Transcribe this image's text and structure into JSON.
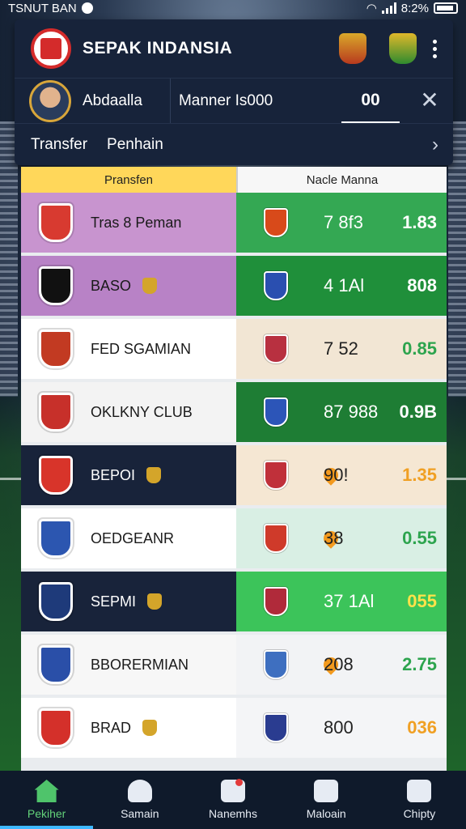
{
  "status": {
    "left_text": "TSNUT BAN",
    "battery": "8:2%"
  },
  "header": {
    "title": "SEPAK INDANSIA",
    "user_name": "Abdaalla",
    "manager_text": "Manner Is000",
    "score": "00",
    "tabs": [
      "Transfer",
      "Penhain"
    ]
  },
  "table": {
    "col1": "Pransfen",
    "col2": "Nacle Manna",
    "rows": [
      {
        "name": "Tras 8 Peman",
        "v1": "7 8f3",
        "v2": "1.83",
        "left_bg": "#c894cf",
        "right_bg": "#34a853",
        "dark": false,
        "v2_color": "#ffffff",
        "v1_color": "#ffffff",
        "pin": false,
        "mini": false,
        "badge_l": "#d83a30",
        "badge_r": "#d84a1a"
      },
      {
        "name": "BASO",
        "v1": "4 1Al",
        "v2": "808",
        "left_bg": "#b882c6",
        "right_bg": "#1f8f3a",
        "dark": false,
        "v2_color": "#ffffff",
        "v1_color": "#ffffff",
        "pin": false,
        "mini": true,
        "badge_l": "#111111",
        "badge_r": "#2a4fb0"
      },
      {
        "name": "FED SGAMIAN",
        "v1": "7 52",
        "v2": "0.85",
        "left_bg": "#ffffff",
        "right_bg": "#f2e6d4",
        "dark": false,
        "v2_color": "#2da44e",
        "v1_color": "#222222",
        "pin": false,
        "mini": false,
        "badge_l": "#c23a22",
        "badge_r": "#b83040"
      },
      {
        "name": "OKLKNY CLUB",
        "v1": "87 988",
        "v2": "0.9B",
        "left_bg": "#f3f3f3",
        "right_bg": "#1e7d34",
        "dark": false,
        "v2_color": "#ffffff",
        "v1_color": "#ffffff",
        "pin": false,
        "mini": false,
        "badge_l": "#c7302a",
        "badge_r": "#2c55b8"
      },
      {
        "name": "BEPOI",
        "v1": "90!",
        "v2": "1.35",
        "left_bg": "#18233a",
        "right_bg": "#f5e7d3",
        "dark": true,
        "v2_color": "#f0a024",
        "v1_color": "#222222",
        "pin": true,
        "mini": true,
        "badge_l": "#d8342a",
        "badge_r": "#c0303a"
      },
      {
        "name": "OEDGEANR",
        "v1": "38",
        "v2": "0.55",
        "left_bg": "#ffffff",
        "right_bg": "#d9efe4",
        "dark": false,
        "v2_color": "#2da44e",
        "v1_color": "#222222",
        "pin": true,
        "mini": false,
        "badge_l": "#2c56b0",
        "badge_r": "#cf3a2a"
      },
      {
        "name": "SEPMI",
        "v1": "37 1Al",
        "v2": "055",
        "left_bg": "#18233a",
        "right_bg": "#3cc45a",
        "dark": true,
        "v2_color": "#ffe24a",
        "v1_color": "#ffffff",
        "pin": false,
        "mini": true,
        "badge_l": "#1e3a7a",
        "badge_r": "#b02a3a"
      },
      {
        "name": "BBORERMIAN",
        "v1": "208",
        "v2": "2.75",
        "left_bg": "#f7f7f7",
        "right_bg": "#f2f3f5",
        "dark": false,
        "v2_color": "#2da44e",
        "v1_color": "#222222",
        "pin": true,
        "mini": false,
        "badge_l": "#2a4fa8",
        "badge_r": "#3e6fc0"
      },
      {
        "name": "BRAD",
        "v1": "800",
        "v2": "036",
        "left_bg": "#ffffff",
        "right_bg": "#f4f5f7",
        "dark": false,
        "v2_color": "#f0a024",
        "v1_color": "#222222",
        "pin": false,
        "mini": true,
        "badge_l": "#d4302a",
        "badge_r": "#2a3c90"
      }
    ]
  },
  "nav": [
    {
      "label": "Pekiher",
      "active": true
    },
    {
      "label": "Samain",
      "active": false
    },
    {
      "label": "Nanemhs",
      "active": false
    },
    {
      "label": "Maloain",
      "active": false
    },
    {
      "label": "Chipty",
      "active": false
    }
  ]
}
